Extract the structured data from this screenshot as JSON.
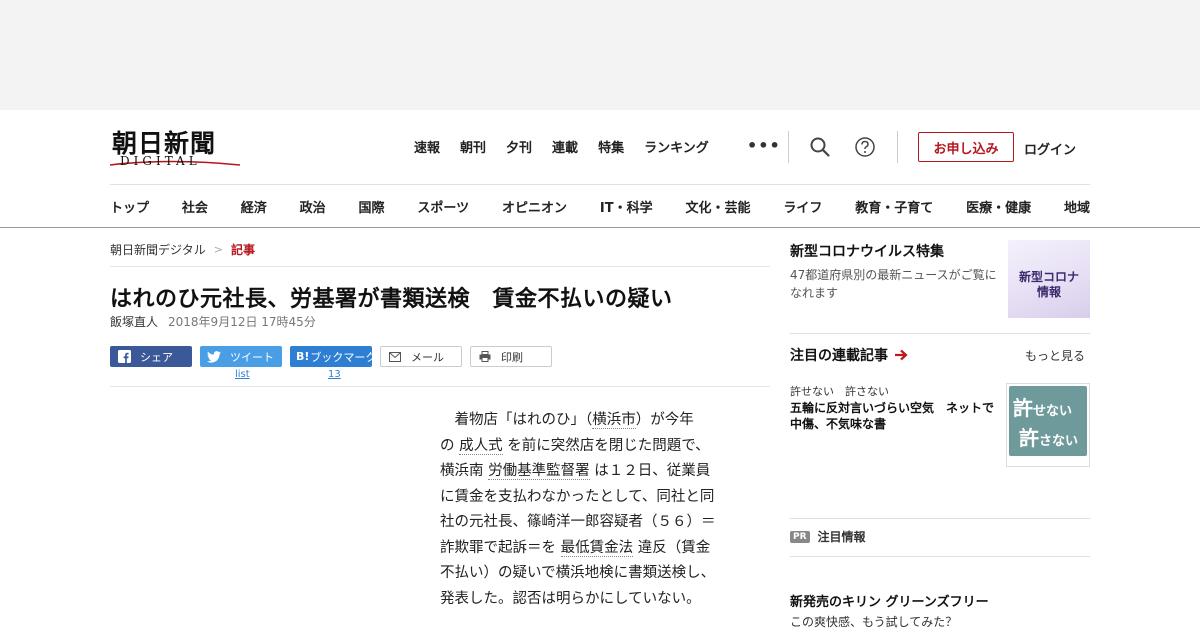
{
  "header": {
    "logo_main": "朝日新聞",
    "logo_sub": "DIGITAL",
    "top_nav": [
      "速報",
      "朝刊",
      "夕刊",
      "連載",
      "特集",
      "ランキング"
    ],
    "more": "•••",
    "apply_label": "お申し込み",
    "login_label": "ログイン",
    "categories": [
      "トップ",
      "社会",
      "経済",
      "政治",
      "国際",
      "スポーツ",
      "オピニオン",
      "IT・科学",
      "文化・芸能",
      "ライフ",
      "教育・子育て",
      "医療・健康",
      "地域"
    ]
  },
  "breadcrumb": {
    "home": "朝日新聞デジタル",
    "separator": ">",
    "current": "記事"
  },
  "article": {
    "headline": "はれのひ元社長、労基署が書類送検　賃金不払いの疑い",
    "author": "飯塚直人",
    "date": "2018年9月12日 17時45分",
    "share": {
      "facebook": "シェア",
      "twitter": "ツイート",
      "twitter_count": "list",
      "hatena_icon": "B!",
      "hatena": "ブックマーク",
      "hatena_count": "13",
      "mail": "メール",
      "print": "印刷"
    },
    "body": {
      "l1": "着物店「はれのひ」（",
      "l1_kw": "横浜市",
      "l1_end": "）が今年",
      "l2_pre": "の",
      "l2_kw": "成人式",
      "l2_end": "を前に突然店を閉じた問題で、",
      "l3_pre": "横浜南",
      "l3_kw": "労働基準監督署",
      "l3_end": "は１２日、従業員",
      "l4": "に賃金を支払わなかったとして、同社と同",
      "l5": "社の元社長、篠崎洋一郎容疑者（５６）＝",
      "l6_pre": "詐欺罪で起訴＝を",
      "l6_kw": "最低賃金法",
      "l6_end": "違反（賃金",
      "l7": "不払い）の疑いで横浜地検に書類送検し、",
      "l8": "発表した。認否は明らかにしていない。"
    }
  },
  "sidebar": {
    "corona": {
      "title": "新型コロナウイルス特集",
      "desc": "47都道府県別の最新ニュースがご覧になれます",
      "img_l1": "新型コロナ",
      "img_l2": "情報"
    },
    "series": {
      "title": "注目の連載記事",
      "more": "もっと見る",
      "kicker": "許せない　許さない",
      "headline": "五輪に反対言いづらい空気　ネットで中傷、不気味な書",
      "img_t1_a": "許",
      "img_t1_b": "せない",
      "img_t2_a": "許",
      "img_t2_b": "さない"
    },
    "pr": {
      "badge": "PR",
      "label": "注目情報"
    },
    "ad": {
      "title": "新発売のキリン グリーンズフリー",
      "sub": "この爽快感、もう試してみた？"
    }
  },
  "colors": {
    "accent": "#b5161d",
    "facebook": "#3b5998",
    "twitter": "#4a9ee6",
    "hatena": "#2e7fd4"
  }
}
